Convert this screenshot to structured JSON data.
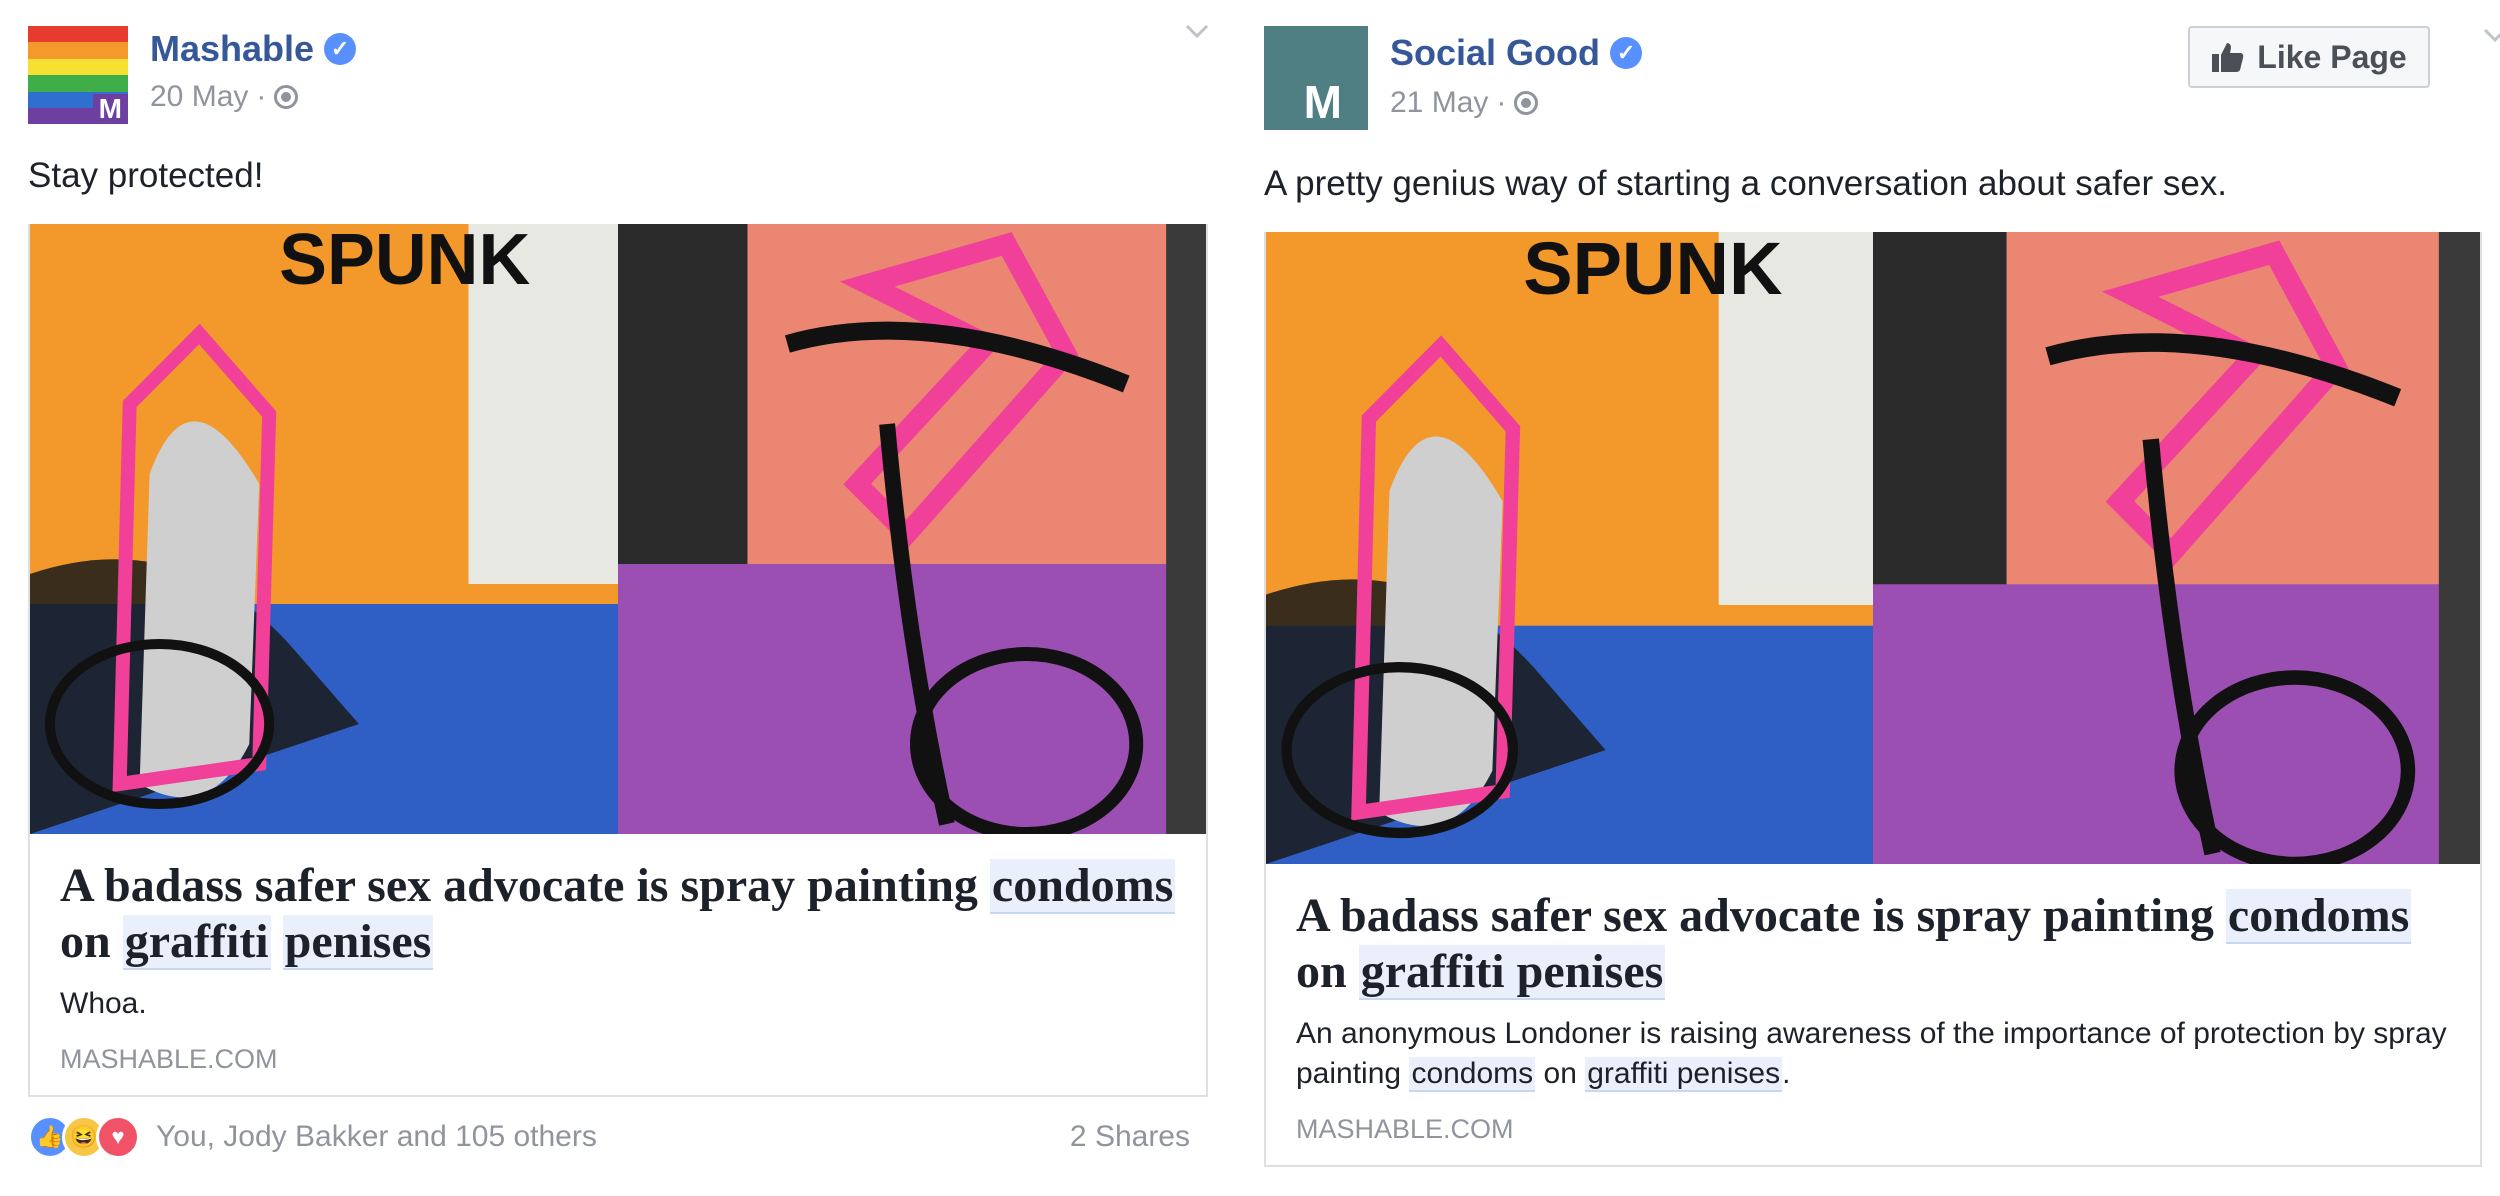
{
  "posts": [
    {
      "page_name": "Mashable",
      "date": "20 May",
      "separator": "·",
      "text": "Stay protected!",
      "avatar_letter": "M",
      "avatar_colors": [
        "#e63b2e",
        "#f39a2b",
        "#f6e032",
        "#3fae49",
        "#2f6fd0",
        "#6c3fa0"
      ],
      "card": {
        "title_parts": [
          "A badass safer sex advocate is spray painting ",
          "condoms",
          " on ",
          "graffiti",
          " ",
          "penises"
        ],
        "description": "Whoa.",
        "domain": "MASHABLE.COM"
      },
      "footer": {
        "reactions_text": "You, Jody Bakker and 105 others",
        "shares": "2 Shares"
      }
    },
    {
      "page_name": "Social Good",
      "date": "21 May",
      "separator": "·",
      "text": "A pretty genius way of starting a conversation about safer sex.",
      "avatar_letter": "M",
      "avatar_color": "#4f7e83",
      "like_button": "Like Page",
      "card": {
        "title_parts": [
          "A badass safer sex advocate is spray painting ",
          "condoms",
          " on ",
          "graffiti penises"
        ],
        "description_parts": [
          "An anonymous Londoner is raising awareness of the importance of protection by spray painting ",
          "condoms",
          " on ",
          "graffiti penises",
          "."
        ],
        "domain": "MASHABLE.COM"
      }
    }
  ],
  "colors": {
    "link_blue": "#365899",
    "meta_gray": "#90949c",
    "verified_blue": "#5890ff",
    "highlight": "#e9f0fb"
  },
  "icons": [
    "verified-badge-icon",
    "globe-icon",
    "chevron-down-icon",
    "thumbs-up-icon",
    "like-reaction-icon",
    "haha-reaction-icon",
    "love-reaction-icon"
  ]
}
